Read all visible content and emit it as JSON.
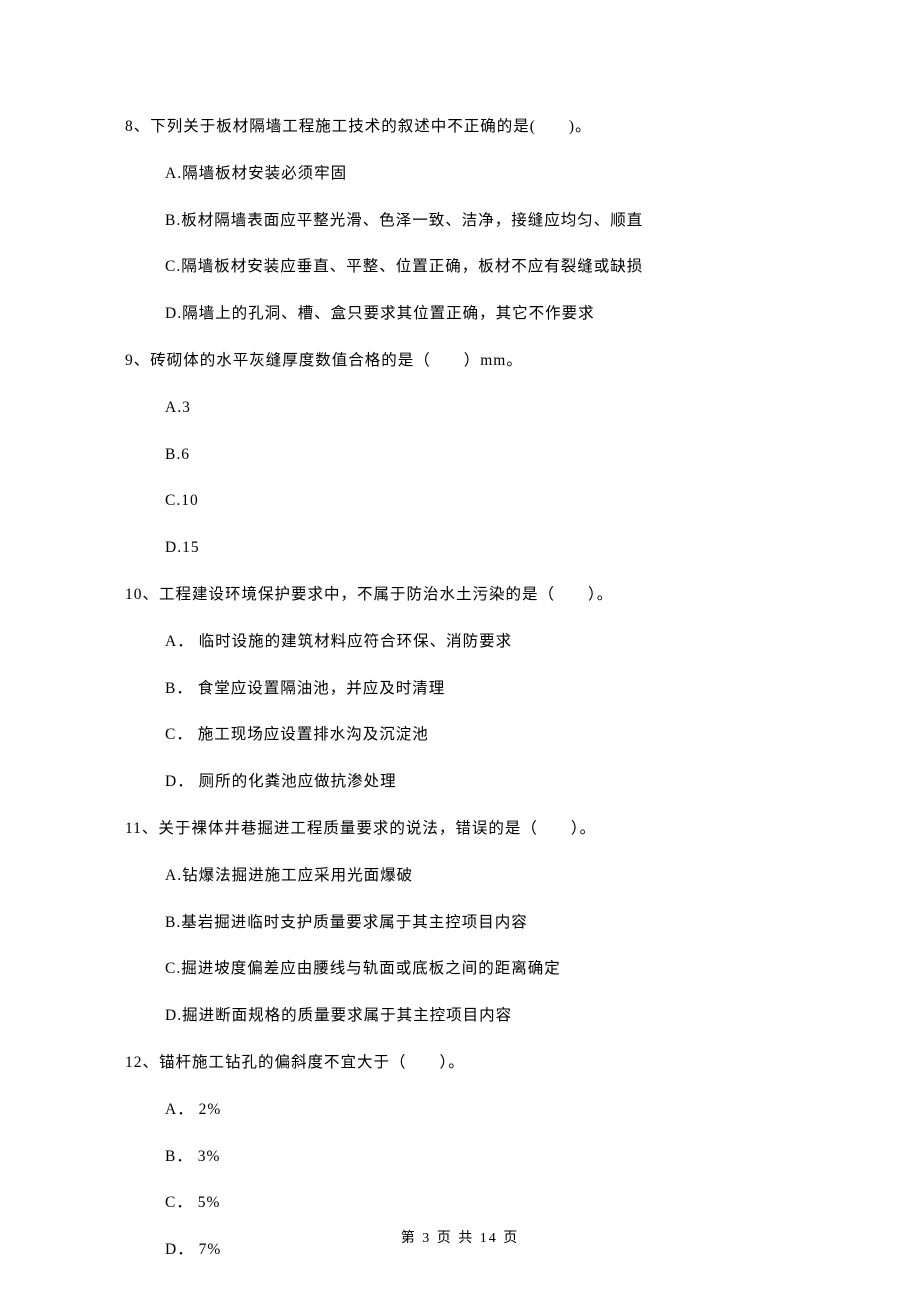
{
  "questions": [
    {
      "stem": "8、下列关于板材隔墙工程施工技术的叙述中不正确的是(　　)。",
      "options": [
        "A.隔墙板材安装必须牢固",
        "B.板材隔墙表面应平整光滑、色泽一致、洁净，接缝应均匀、顺直",
        "C.隔墙板材安装应垂直、平整、位置正确，板材不应有裂缝或缺损",
        "D.隔墙上的孔洞、槽、盒只要求其位置正确，其它不作要求"
      ]
    },
    {
      "stem": "9、砖砌体的水平灰缝厚度数值合格的是（　　）mm。",
      "options": [
        "A.3",
        "B.6",
        "C.10",
        "D.15"
      ]
    },
    {
      "stem": "10、工程建设环境保护要求中，不属于防治水土污染的是（　　）。",
      "options": [
        "A． 临时设施的建筑材料应符合环保、消防要求",
        "B． 食堂应设置隔油池，并应及时清理",
        "C． 施工现场应设置排水沟及沉淀池",
        "D． 厕所的化粪池应做抗渗处理"
      ]
    },
    {
      "stem": "11、关于裸体井巷掘进工程质量要求的说法，错误的是（　　）。",
      "options": [
        "A.钻爆法掘进施工应采用光面爆破",
        "B.基岩掘进临时支护质量要求属于其主控项目内容",
        "C.掘进坡度偏差应由腰线与轨面或底板之间的距离确定",
        "D.掘进断面规格的质量要求属于其主控项目内容"
      ]
    },
    {
      "stem": "12、锚杆施工钻孔的偏斜度不宜大于（　　）。",
      "options": [
        "A． 2%",
        "B． 3%",
        "C． 5%",
        "D． 7%"
      ]
    }
  ],
  "footer": "第 3 页 共 14 页"
}
